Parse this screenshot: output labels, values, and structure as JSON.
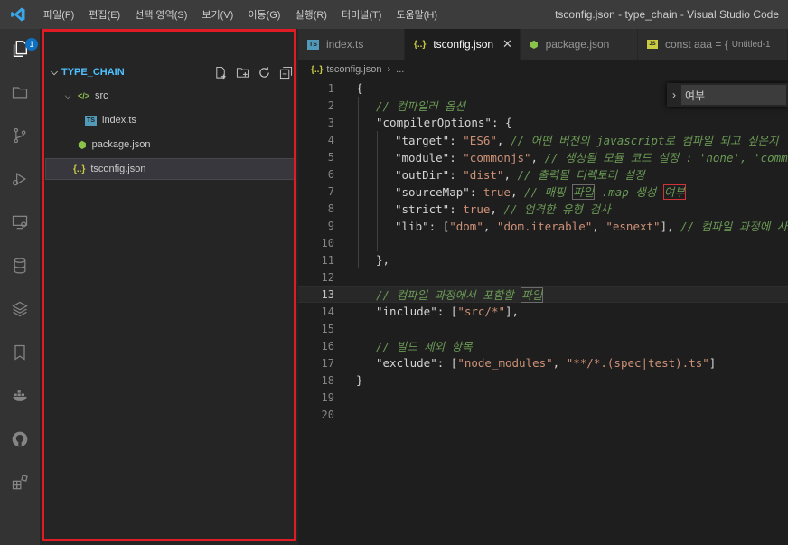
{
  "menu": [
    "파일(F)",
    "편집(E)",
    "선택 영역(S)",
    "보기(V)",
    "이동(G)",
    "실행(R)",
    "터미널(T)",
    "도움말(H)"
  ],
  "window_title": "tsconfig.json - type_chain - Visual Studio Code",
  "activity": {
    "badge_count": "1"
  },
  "explorer": {
    "folder_name": "TYPE_CHAIN",
    "items": [
      {
        "label": "src",
        "type": "folder"
      },
      {
        "label": "index.ts",
        "type": "ts"
      },
      {
        "label": "package.json",
        "type": "node"
      },
      {
        "label": "tsconfig.json",
        "type": "json"
      }
    ]
  },
  "tabs": [
    {
      "label": "index.ts",
      "icon": "TS"
    },
    {
      "label": "tsconfig.json",
      "icon": "{..}"
    },
    {
      "label": "package.json",
      "icon": "⬢"
    },
    {
      "label": "const aaa = {",
      "sub": "Untitled-1",
      "icon": "JS"
    }
  ],
  "breadcrumb": {
    "file": "tsconfig.json",
    "rest": "..."
  },
  "find": {
    "value": "여부"
  },
  "editor": {
    "line_numbers": [
      "1",
      "2",
      "3",
      "4",
      "5",
      "6",
      "7",
      "8",
      "9",
      "10",
      "11",
      "12",
      "13",
      "14",
      "15",
      "16",
      "17",
      "18",
      "19",
      "20"
    ],
    "current_line": "13",
    "comment_2": "// 컴파일러 옵션",
    "key_compilerOptions": "\"compilerOptions\"",
    "key_target": "\"target\"",
    "val_target": "\"ES6\"",
    "comment_4": "// 어떤 버전의 javascript로 컴파일 되고 싶은지",
    "key_module": "\"module\"",
    "val_module": "\"commonjs\"",
    "comment_5": "// 생성될 모듈 코드 설정 : 'none', 'commo",
    "key_outDir": "\"outDir\"",
    "val_outDir": "\"dist\"",
    "comment_6": "// 출력될 디렉토리 설정",
    "key_sourceMap": "\"sourceMap\"",
    "val_true": "true",
    "comment_7a": "// 매핑 ",
    "comment_7b": "파일",
    "comment_7c": " .map 생성 ",
    "comment_7d": "여부",
    "key_strict": "\"strict\"",
    "comment_8": "// 엄격한 유형 검사",
    "key_lib": "\"lib\"",
    "lib_1": "\"dom\"",
    "lib_2": "\"dom.iterable\"",
    "lib_3": "\"esnext\"",
    "comment_9": "// 컴파일 과정에 사용",
    "comment_13a": "// 컴파일 과정에서 포함할 ",
    "comment_13b": "파일",
    "key_include": "\"include\"",
    "val_include": "\"src/*\"",
    "comment_16": "// 빌드 제외 항목",
    "key_exclude": "\"exclude\"",
    "val_exclude_1": "\"node_modules\"",
    "val_exclude_2": "\"**/*.(spec|test).ts\""
  },
  "colors": {
    "highlight_border": "#e01b24",
    "accent": "#0e70c0"
  }
}
